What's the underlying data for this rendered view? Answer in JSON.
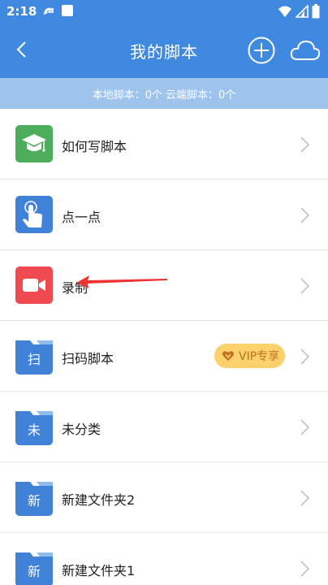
{
  "status_bar": {
    "time": "2:18"
  },
  "nav": {
    "title": "我的脚本"
  },
  "summary": {
    "local": "本地脚本：0个",
    "cloud": "云端脚本：0个"
  },
  "items": [
    {
      "label": "如何写脚本",
      "letter": ""
    },
    {
      "label": "点一点",
      "letter": ""
    },
    {
      "label": "录制",
      "letter": ""
    },
    {
      "label": "扫码脚本",
      "letter": "扫",
      "badge": "VIP专享"
    },
    {
      "label": "未分类",
      "letter": "未"
    },
    {
      "label": "新建文件夹2",
      "letter": "新"
    },
    {
      "label": "新建文件夹1",
      "letter": "新"
    }
  ],
  "colors": {
    "primary": "#3f89e0",
    "summary_bg": "#9ec3ec",
    "green_icon": "#4cae5a",
    "blue_icon": "#3f82d8",
    "red_icon": "#ef4a4f",
    "vip_bg": "#fcd16b",
    "vip_text": "#c0711e",
    "annotation": "#e33"
  }
}
